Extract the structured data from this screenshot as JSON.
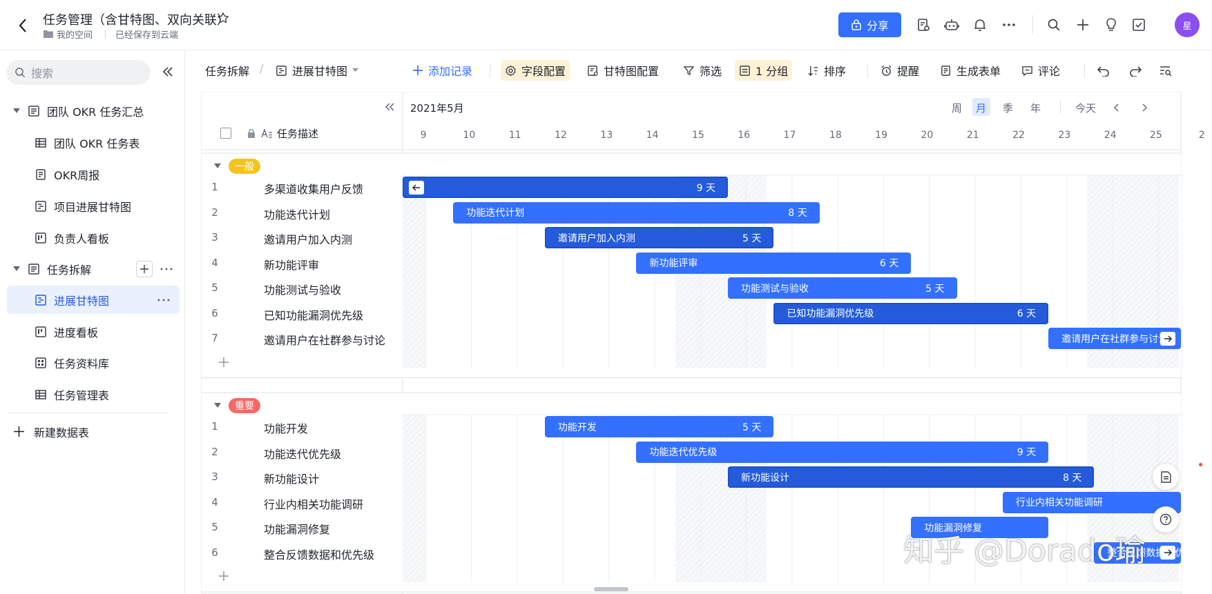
{
  "header": {
    "title": "任务管理（含甘特图、双向关联）",
    "breadcrumb": "我的空间",
    "save_status": "已经保存到云端",
    "share_label": "分享",
    "avatar_text": "星",
    "accent": "#3370ff"
  },
  "sidebar": {
    "search_placeholder": "搜索",
    "items": [
      {
        "label": "团队 OKR 任务汇总",
        "icon": "doc-icon"
      },
      {
        "label": "团队 OKR 任务表",
        "icon": "table-icon"
      },
      {
        "label": "OKR周报",
        "icon": "form-icon"
      },
      {
        "label": "项目进展甘特图",
        "icon": "gantt-icon"
      },
      {
        "label": "负责人看板",
        "icon": "kanban-icon"
      },
      {
        "label": "任务拆解",
        "icon": "doc-icon"
      },
      {
        "label": "进展甘特图",
        "icon": "gantt-icon"
      },
      {
        "label": "进度看板",
        "icon": "kanban-icon"
      },
      {
        "label": "任务资料库",
        "icon": "gallery-icon"
      },
      {
        "label": "任务管理表",
        "icon": "table-icon"
      }
    ],
    "new_table": "新建数据表"
  },
  "toolbar": {
    "crumb_parent": "任务拆解",
    "crumb_view": "进展甘特图",
    "add_record": "添加记录",
    "field_config": "字段配置",
    "gantt_config": "甘特图配置",
    "filter": "筛选",
    "group": "1 分组",
    "sort": "排序",
    "remind": "提醒",
    "form": "生成表单",
    "comment": "评论"
  },
  "gantt": {
    "month_label": "2021年5月",
    "scales": [
      "周",
      "月",
      "季",
      "年"
    ],
    "active_scale": "月",
    "today": "今天",
    "column_header": "任务描述",
    "days": [
      "9",
      "10",
      "11",
      "12",
      "13",
      "14",
      "15",
      "16",
      "17",
      "18",
      "19",
      "20",
      "21",
      "22",
      "23",
      "24",
      "25",
      "2"
    ],
    "groups": [
      {
        "tag": "一般",
        "tag_bg": "#f5c320",
        "tag_color": "#ffffff",
        "rows": [
          {
            "num": "1",
            "desc": "多渠道收集用户反馈",
            "bar_name": "",
            "duration": "9 天"
          },
          {
            "num": "2",
            "desc": "功能迭代计划",
            "bar_name": "功能迭代计划",
            "duration": "8 天"
          },
          {
            "num": "3",
            "desc": "邀请用户加入内测",
            "bar_name": "邀请用户加入内测",
            "duration": "5 天"
          },
          {
            "num": "4",
            "desc": "新功能评审",
            "bar_name": "新功能评审",
            "duration": "6 天"
          },
          {
            "num": "5",
            "desc": "功能测试与验收",
            "bar_name": "功能测试与验收",
            "duration": "5 天"
          },
          {
            "num": "6",
            "desc": "已知功能漏洞优先级",
            "bar_name": "已知功能漏洞优先级",
            "duration": "6 天"
          },
          {
            "num": "7",
            "desc": "邀请用户在社群参与讨论",
            "bar_name": "邀请用户在社群参与讨论",
            "duration": ""
          }
        ]
      },
      {
        "tag": "重要",
        "tag_bg": "#f76964",
        "tag_color": "#ffffff",
        "rows": [
          {
            "num": "1",
            "desc": "功能开发",
            "bar_name": "功能开发",
            "duration": "5 天"
          },
          {
            "num": "2",
            "desc": "功能迭代优先级",
            "bar_name": "功能迭代优先级",
            "duration": "9 天"
          },
          {
            "num": "3",
            "desc": "新功能设计",
            "bar_name": "新功能设计",
            "duration": "8 天"
          },
          {
            "num": "4",
            "desc": "行业内相关功能调研",
            "bar_name": "行业内相关功能调研",
            "duration": ""
          },
          {
            "num": "5",
            "desc": "功能漏洞修复",
            "bar_name": "功能漏洞修复",
            "duration": ""
          },
          {
            "num": "6",
            "desc": "整合反馈数据和优先级",
            "bar_name": "整合反馈数据和优先级",
            "duration": ""
          }
        ]
      }
    ]
  },
  "watermark": "知乎 @Dorado瑜"
}
